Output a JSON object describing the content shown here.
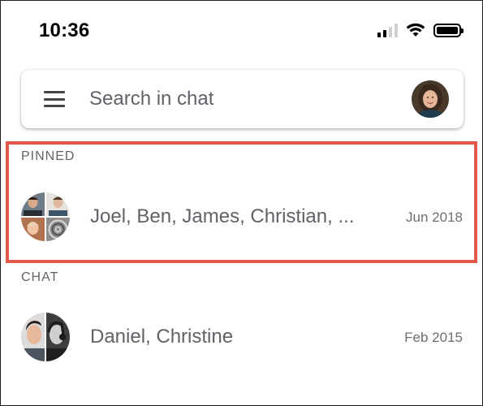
{
  "status_bar": {
    "time": "10:36",
    "icons": [
      "cellular-signal-icon",
      "wifi-icon",
      "battery-icon"
    ]
  },
  "search": {
    "menu_icon": "hamburger-menu-icon",
    "placeholder": "Search in chat",
    "avatar": "user-profile-avatar"
  },
  "sections": {
    "pinned_label": "PINNED",
    "chat_label": "CHAT"
  },
  "pinned_chats": [
    {
      "title": "Joel, Ben, James, Christian, ...",
      "date": "Jun 2018",
      "avatar": "group-avatar-four-people"
    }
  ],
  "chats": [
    {
      "title": "Daniel, Christine",
      "date": "Feb 2015",
      "avatar": "group-avatar-two-people"
    }
  ],
  "colors": {
    "highlight_border": "#e4574b",
    "primary_text": "#5f6368",
    "section_label": "#5f6368",
    "background": "#ffffff"
  }
}
